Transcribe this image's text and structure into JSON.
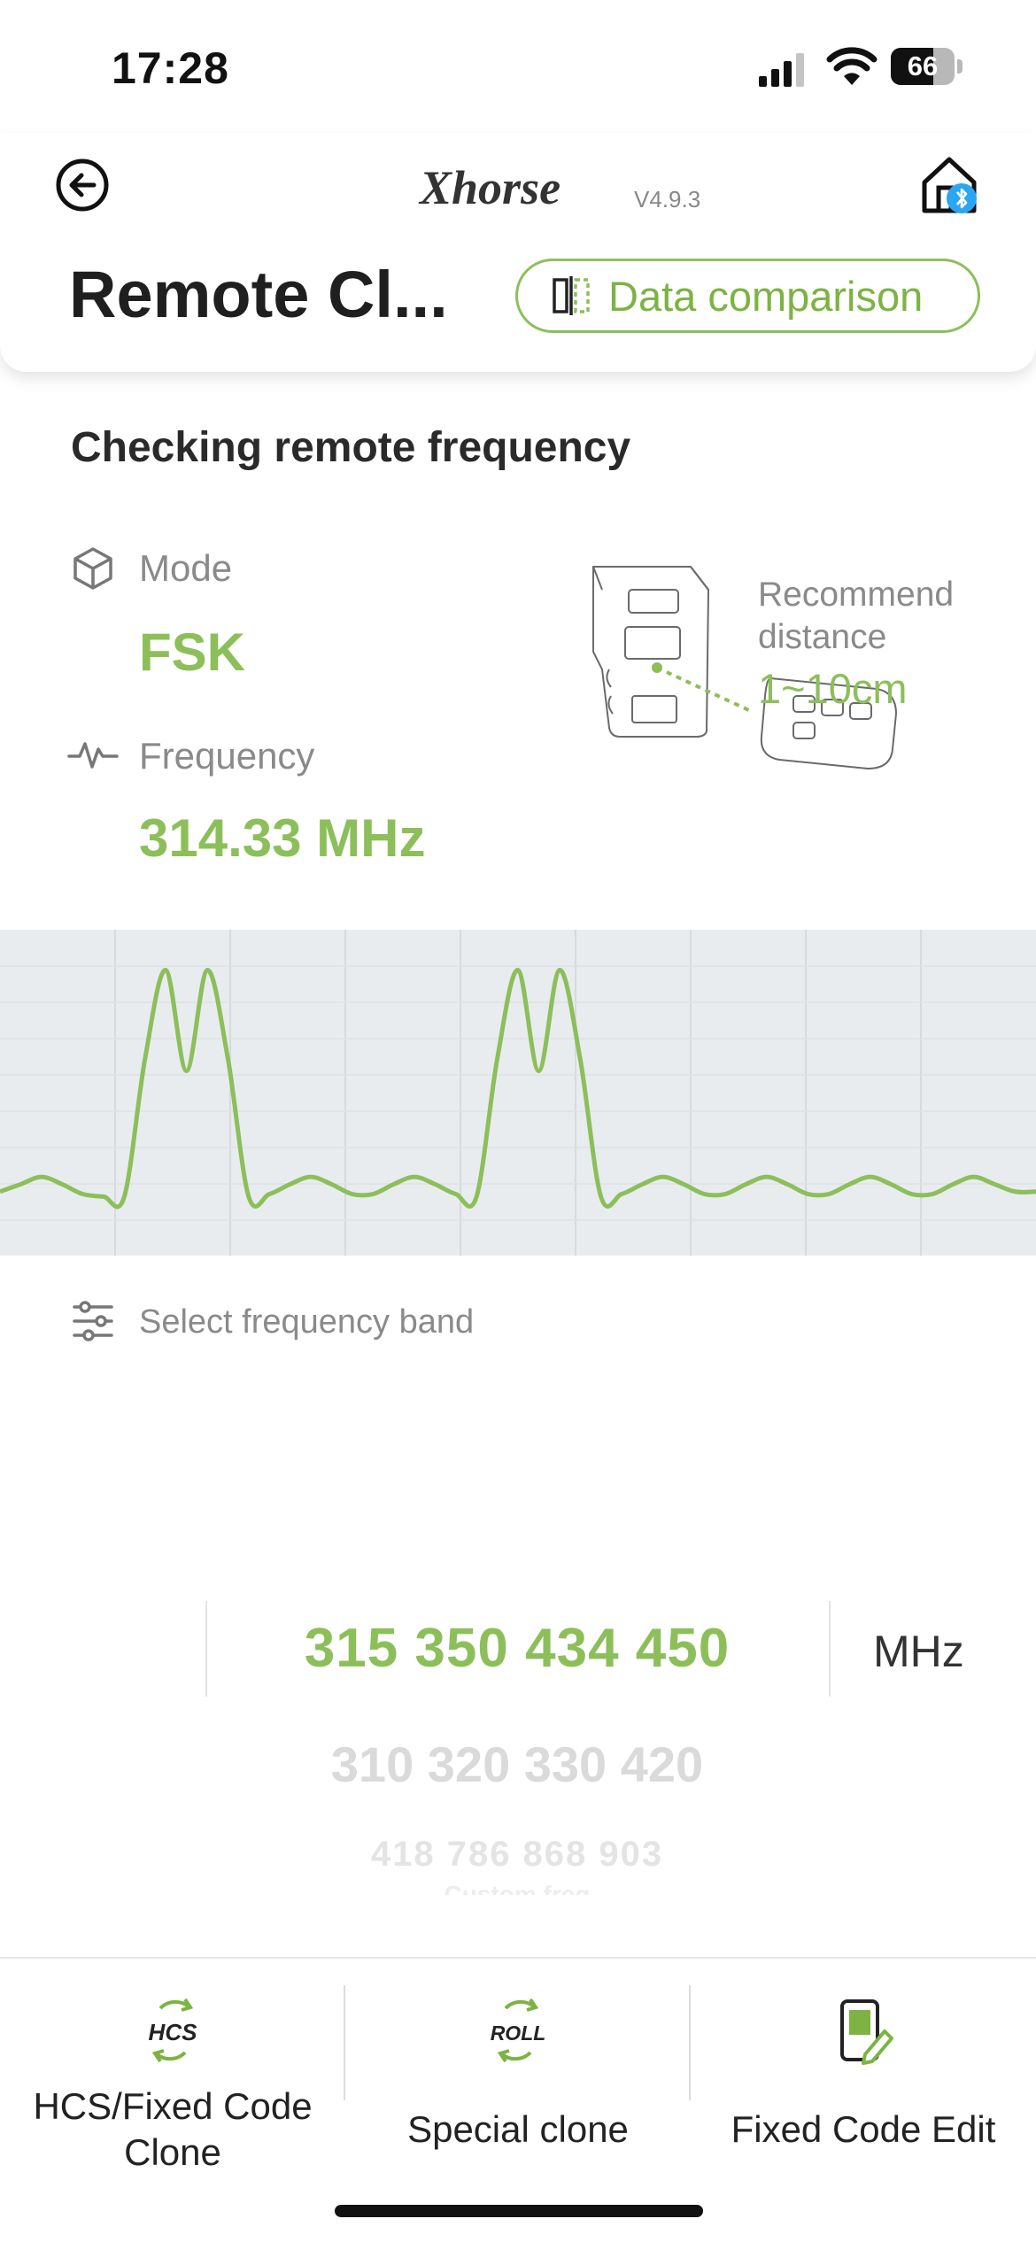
{
  "status_bar": {
    "time": "17:28",
    "battery": "66",
    "battery_level": 0.66
  },
  "header": {
    "brand": "Xhorse",
    "version": "V4.9.3",
    "title": "Remote Cl...",
    "compare_button": "Data comparison"
  },
  "status": {
    "heading": "Checking remote frequency",
    "mode_label": "Mode",
    "mode_value": "FSK",
    "frequency_label": "Frequency",
    "frequency_value": "314.33 MHz",
    "recommend_label": "Recommend distance",
    "recommend_value": "1~10cm"
  },
  "chart_data": {
    "type": "line",
    "title": "",
    "xlabel": "",
    "ylabel": "",
    "grid": true,
    "color": "#8cbf5a",
    "background": "#e8ecef",
    "description_free": true,
    "x": [
      0,
      2,
      4,
      6,
      8,
      10,
      12,
      14,
      16,
      18,
      20,
      22,
      24,
      26,
      28,
      30,
      32,
      34,
      36,
      38,
      40,
      42,
      44,
      46,
      48,
      50,
      52,
      54,
      56,
      58,
      60,
      62,
      64,
      66,
      68,
      70,
      72,
      74,
      76,
      78,
      80,
      82,
      84,
      86,
      88,
      90,
      92,
      94,
      96,
      98,
      100
    ],
    "values": [
      0.08,
      0.11,
      0.14,
      0.11,
      0.07,
      0.06,
      0.06,
      0.62,
      0.98,
      0.57,
      0.98,
      0.62,
      0.06,
      0.07,
      0.11,
      0.14,
      0.11,
      0.07,
      0.07,
      0.11,
      0.14,
      0.11,
      0.07,
      0.06,
      0.62,
      0.98,
      0.57,
      0.98,
      0.62,
      0.06,
      0.07,
      0.11,
      0.14,
      0.11,
      0.07,
      0.07,
      0.11,
      0.14,
      0.11,
      0.07,
      0.07,
      0.11,
      0.14,
      0.11,
      0.07,
      0.07,
      0.11,
      0.14,
      0.11,
      0.08,
      0.08
    ],
    "ylim": [
      0,
      1
    ]
  },
  "band": {
    "label": "Select frequency band",
    "selected": "315 350 434 450",
    "options_below": [
      "310 320 330 420",
      "418 786 868 903",
      "Custom freq"
    ],
    "unit": "MHz"
  },
  "tabs": [
    {
      "icon_text": "HCS",
      "label_line1": "HCS/Fixed Code",
      "label_line2": "Clone"
    },
    {
      "icon_text": "ROLL",
      "label_line1": "Special clone",
      "label_line2": ""
    },
    {
      "icon_text": "",
      "label_line1": "Fixed Code Edit",
      "label_line2": ""
    }
  ]
}
